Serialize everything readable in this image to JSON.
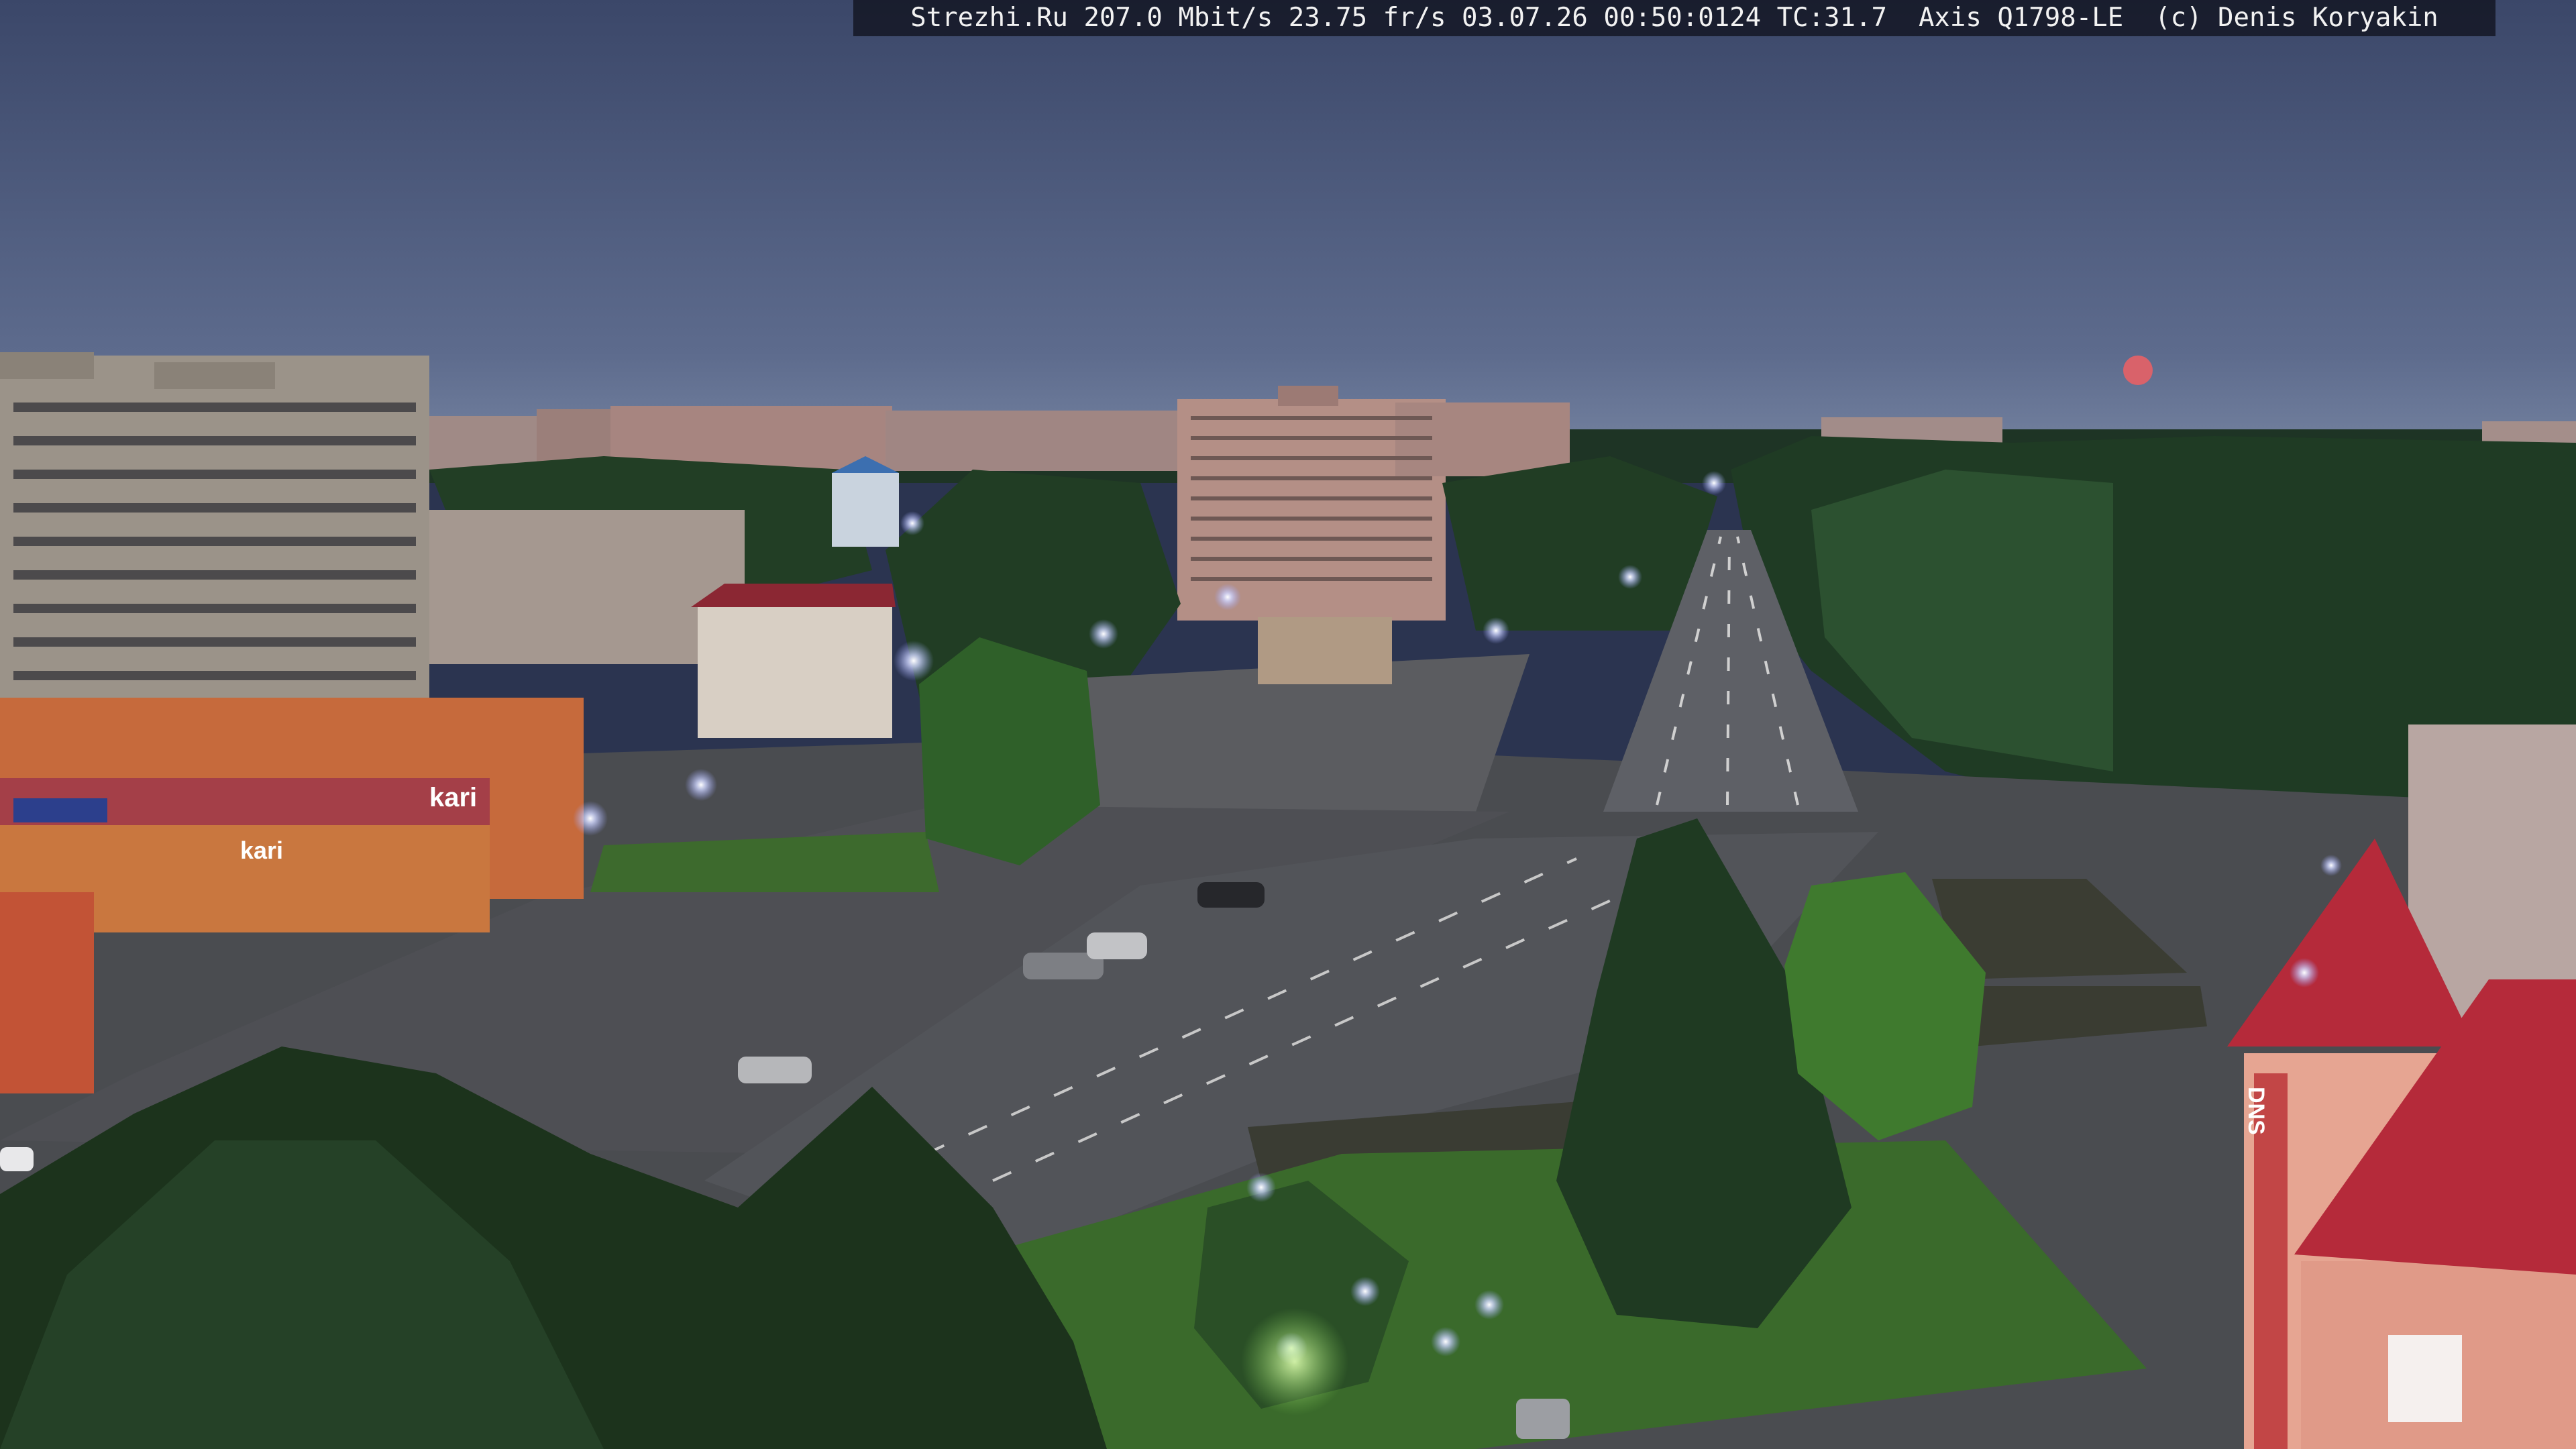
{
  "camera_overlay": {
    "text": "Strezhi.Ru 207.0 Mbit/s 23.75 fr/s 03.07.26 00:50:0124 TC:31.7  Axis Q1798-LE  (c) Denis Koryakin"
  },
  "storefront_signs": {
    "sign_1": "kari",
    "sign_2": "kari",
    "sign_3": "DNS"
  },
  "colors": {
    "sky_top": "#3d4a6e",
    "sky_horizon": "#6c7a98",
    "moon": "#d9626a",
    "road": "#57595f",
    "grass": "#3f6a2e",
    "tree_dark": "#1f3a22",
    "roof_red": "#b52a3a"
  }
}
